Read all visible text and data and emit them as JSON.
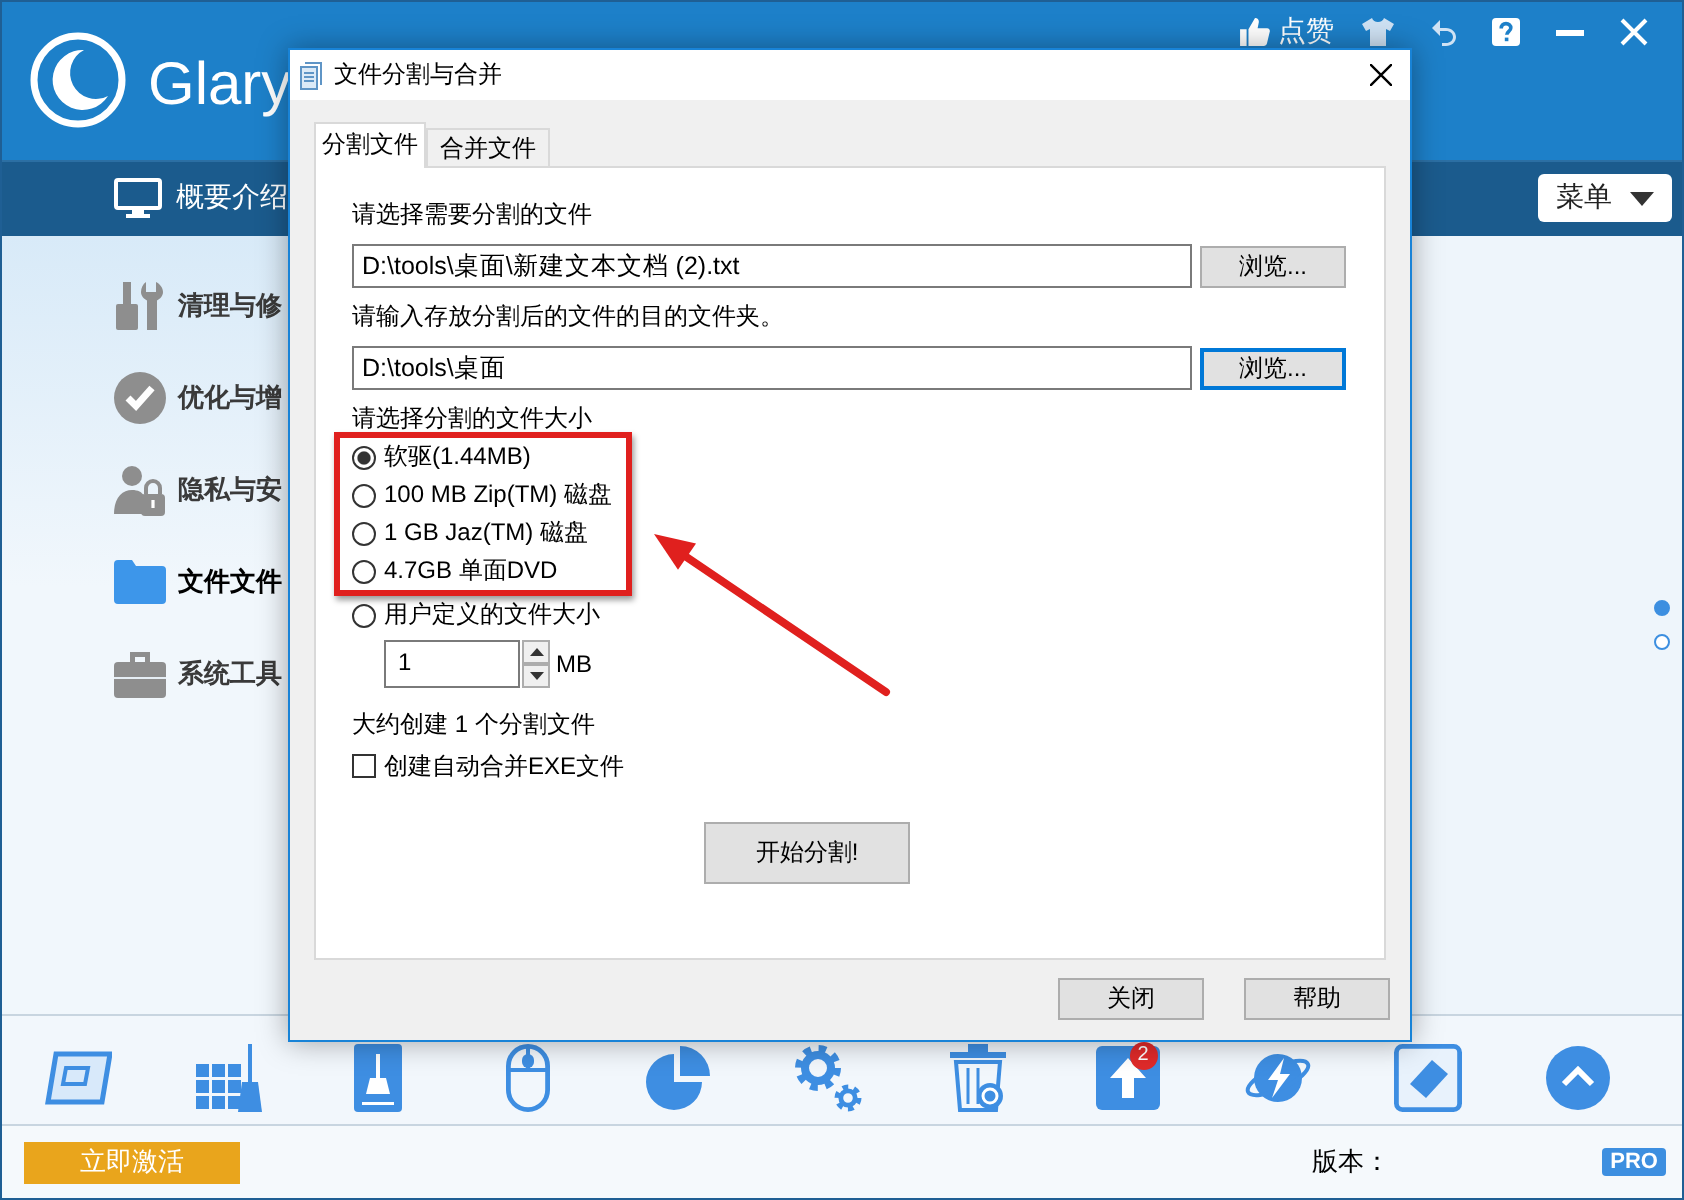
{
  "header": {
    "brand": "Glary",
    "tools": [
      {
        "kind": "like",
        "label": "点赞"
      },
      {
        "kind": "shirt"
      },
      {
        "kind": "undo"
      },
      {
        "kind": "help"
      },
      {
        "kind": "minimize"
      },
      {
        "kind": "close"
      }
    ]
  },
  "nav": {
    "overview_tab": "概要介绍",
    "menu_button": "菜单"
  },
  "sidebar": {
    "items": [
      {
        "kind": "tools",
        "label": "清理与修",
        "selected": false
      },
      {
        "kind": "check",
        "label": "优化与增",
        "selected": false
      },
      {
        "kind": "privacy",
        "label": "隐私与安",
        "selected": false
      },
      {
        "kind": "folder",
        "label": "文件文件",
        "selected": true
      },
      {
        "kind": "toolbox",
        "label": "系统工具",
        "selected": false
      }
    ]
  },
  "pager": [
    {
      "selected": true
    },
    {
      "selected": false
    }
  ],
  "toolbar": {
    "items": [
      {
        "kind": "screen"
      },
      {
        "kind": "grid-broom"
      },
      {
        "kind": "drive-broom"
      },
      {
        "kind": "mouse"
      },
      {
        "kind": "pie"
      },
      {
        "kind": "gears"
      },
      {
        "kind": "trash"
      },
      {
        "kind": "upload",
        "badge": "2"
      },
      {
        "kind": "planet"
      },
      {
        "kind": "screenshot"
      },
      {
        "kind": "up"
      }
    ]
  },
  "status_bar": {
    "activate_button": "立即激活",
    "version_label": "版本：",
    "edition_badge": "PRO"
  },
  "dialog": {
    "title": "文件分割与合并",
    "tabs": [
      {
        "label": "分割文件",
        "selected": true
      },
      {
        "label": "合并文件",
        "selected": false
      }
    ],
    "path_fields": [
      {
        "label": "请选择需要分割的文件",
        "value": "D:\\tools\\桌面\\新建文本文档 (2).txt",
        "button": "浏览...",
        "focused": false
      },
      {
        "label": "请输入存放分割后的文件的目的文件夹。",
        "value": "D:\\tools\\桌面",
        "button": "浏览...",
        "focused": true
      }
    ],
    "size_label": "请选择分割的文件大小",
    "size_options": [
      {
        "label": "软驱(1.44MB)",
        "selected": true,
        "highlighted": true
      },
      {
        "label": "100 MB Zip(TM) 磁盘",
        "selected": false,
        "highlighted": true
      },
      {
        "label": "1 GB Jaz(TM) 磁盘",
        "selected": false,
        "highlighted": true
      },
      {
        "label": "4.7GB 单面DVD",
        "selected": false,
        "highlighted": true
      },
      {
        "label": "用户定义的文件大小",
        "selected": false,
        "highlighted": false
      }
    ],
    "custom_size": {
      "value": "1",
      "unit": "MB"
    },
    "estimate": "大约创建 1 个分割文件",
    "auto_merge": {
      "label": "创建自动合并EXE文件",
      "checked": false
    },
    "start_button": "开始分割!",
    "buttons": [
      "关闭",
      "帮助"
    ]
  }
}
